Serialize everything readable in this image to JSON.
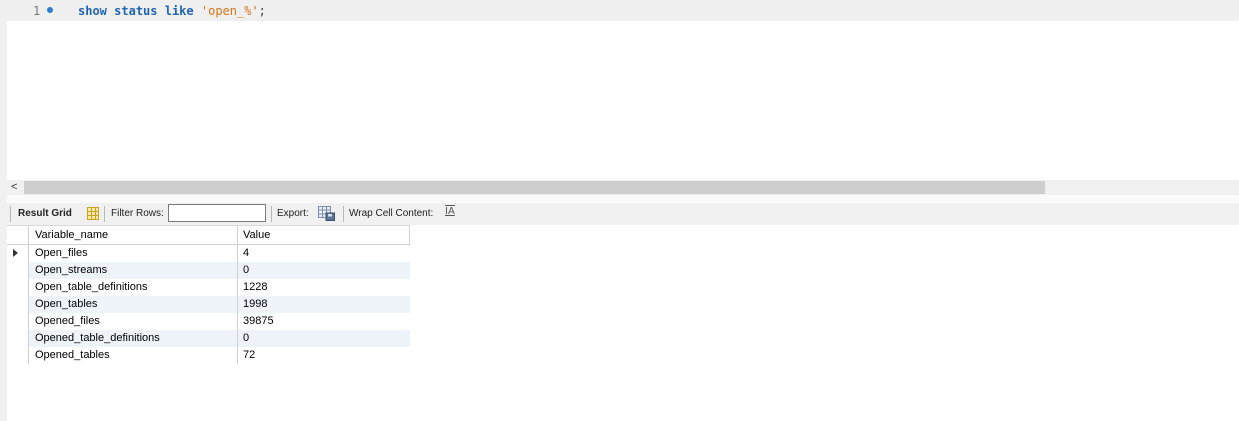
{
  "editor": {
    "line_number": "1",
    "code": {
      "kw1": "show",
      "kw2": "status",
      "kw3": "like",
      "string": "'open_%'",
      "terminator": ";"
    }
  },
  "toolbar": {
    "result_grid_label": "Result Grid",
    "filter_label": "Filter Rows:",
    "filter_value": "",
    "export_label": "Export:",
    "wrap_label": "Wrap Cell Content:",
    "wrap_icon_glyph": "IA"
  },
  "grid": {
    "columns": [
      "Variable_name",
      "Value"
    ],
    "rows": [
      {
        "name": "Open_files",
        "value": "4"
      },
      {
        "name": "Open_streams",
        "value": "0"
      },
      {
        "name": "Open_table_definitions",
        "value": "1228"
      },
      {
        "name": "Open_tables",
        "value": "1998"
      },
      {
        "name": "Opened_files",
        "value": "39875"
      },
      {
        "name": "Opened_table_definitions",
        "value": "0"
      },
      {
        "name": "Opened_tables",
        "value": "72"
      }
    ],
    "selected_row_index": 0
  },
  "colors": {
    "keyword": "#1f64b5",
    "string": "#d9741a",
    "alt_row": "#eef3fa"
  }
}
